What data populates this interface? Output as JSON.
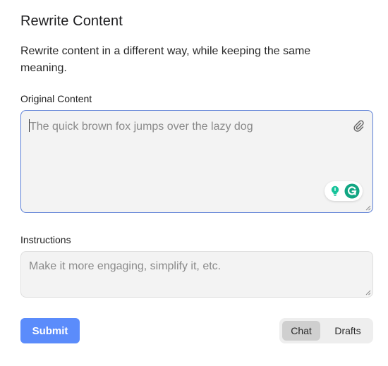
{
  "panel": {
    "title": "Rewrite Content",
    "description": "Rewrite content in a different way, while keeping the same meaning."
  },
  "original_content": {
    "label": "Original Content",
    "placeholder": "The quick brown fox jumps over the lazy dog",
    "value": ""
  },
  "instructions": {
    "label": "Instructions",
    "placeholder": "Make it more engaging, simplify it, etc.",
    "value": ""
  },
  "actions": {
    "submit_label": "Submit"
  },
  "view_toggle": {
    "options": [
      "Chat",
      "Drafts"
    ],
    "selected": "Chat"
  },
  "colors": {
    "accent": "#5b8cfb",
    "focus_border": "#5b7fd6",
    "grammarly_green": "#15c39a",
    "grammarly_dark": "#11a683"
  },
  "icons": {
    "attach": "paperclip-icon",
    "grammarly_suggestion": "lightbulb-icon",
    "grammarly_logo": "grammarly-g-icon"
  }
}
